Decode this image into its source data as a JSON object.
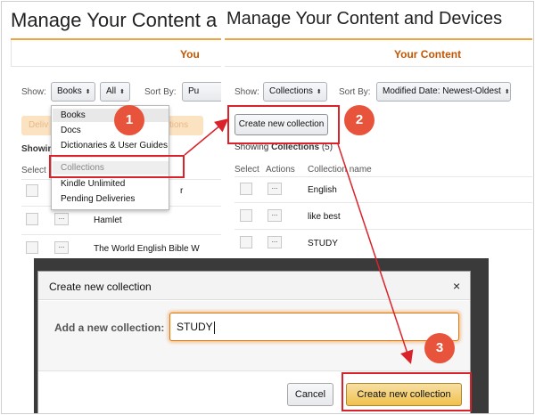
{
  "left_panel": {
    "title": "Manage Your Content a",
    "tab": "You",
    "show_label": "Show:",
    "show_value": "Books",
    "filter_value": "All",
    "sortby_label": "Sort By:",
    "sortby_value": "Pu",
    "ghost_buttons": [
      "Deliv",
      "tions"
    ],
    "showing": "Showing",
    "select_label": "Select",
    "rows": [
      {
        "title": "r"
      },
      {
        "title": "Hamlet"
      },
      {
        "title": "The World English Bible W"
      }
    ],
    "dropdown": {
      "items": [
        "Books",
        "Docs",
        "Dictionaries & User Guides",
        "Collections",
        "Kindle Unlimited",
        "Pending Deliveries"
      ],
      "highlighted": "Books"
    }
  },
  "right_panel": {
    "title": "Manage Your Content and Devices",
    "tab": "Your Content",
    "show_label": "Show:",
    "show_value": "Collections",
    "sortby_label": "Sort By:",
    "sortby_value": "Modified Date: Newest-Oldest",
    "create_button": "Create new collection",
    "showing_prefix": "Showing",
    "showing_bold": "Collections",
    "showing_count": "(5)",
    "columns": [
      "Select",
      "Actions",
      "Collection name"
    ],
    "rows": [
      "English",
      "like best",
      "STUDY"
    ]
  },
  "modal": {
    "title": "Create new collection",
    "close": "×",
    "input_label": "Add a new collection:",
    "input_value": "STUDY",
    "cancel": "Cancel",
    "create": "Create new collection"
  },
  "icons": {
    "dots": "...",
    "caret": "⬍"
  },
  "annotations": {
    "step1": "1",
    "step2": "2",
    "step3": "3",
    "color": "#d9222a",
    "badge_color": "#e8533b"
  }
}
